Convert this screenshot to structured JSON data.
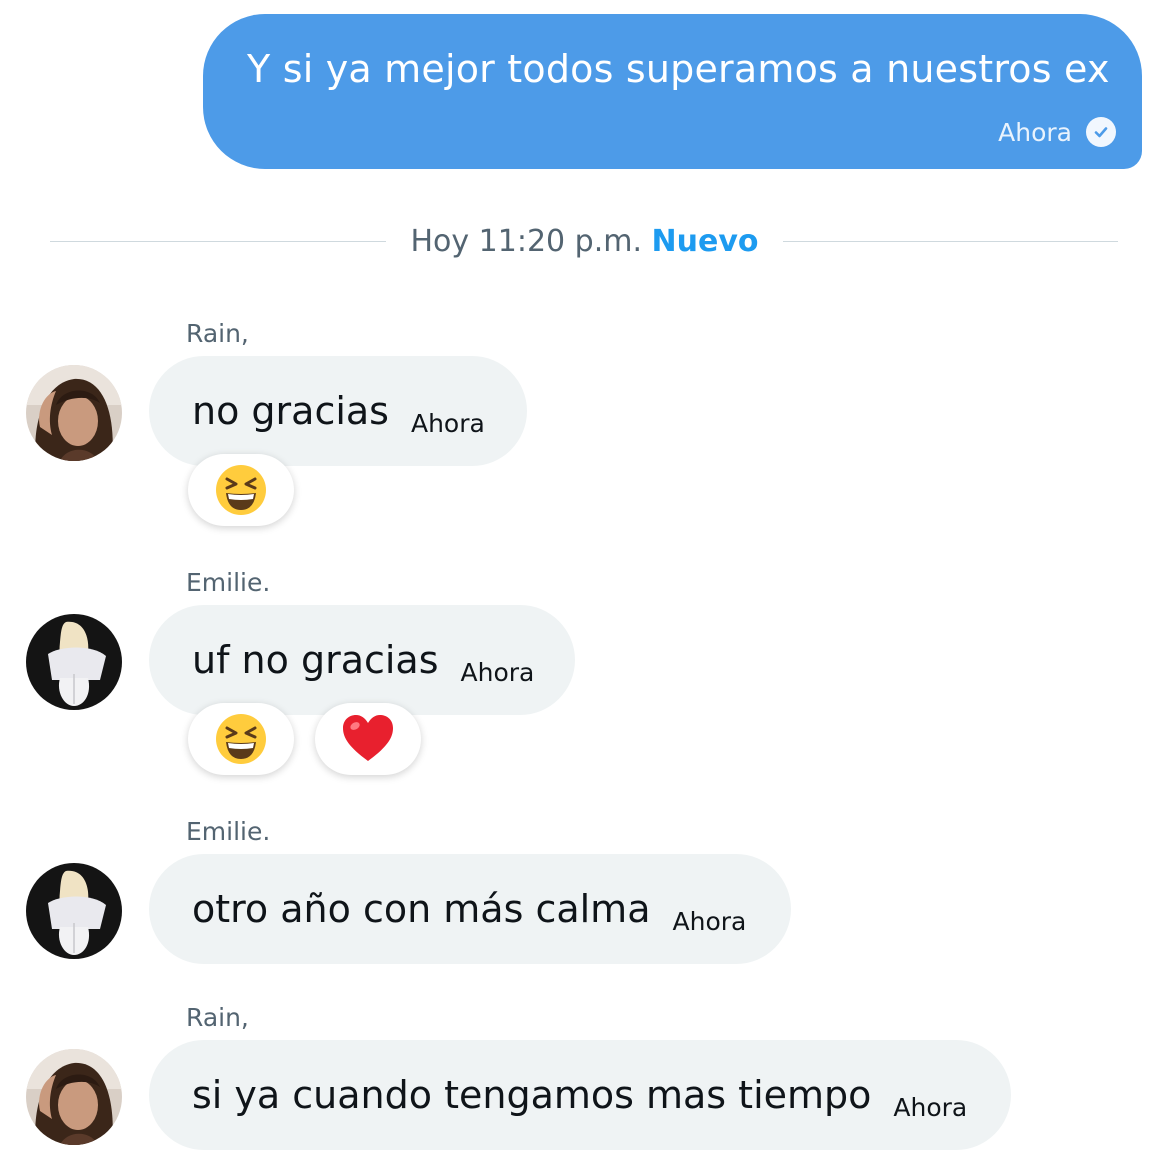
{
  "outgoing": {
    "text": "Y si ya mejor todos superamos a nuestros ex",
    "time": "Ahora",
    "status_icon": "check-circle-icon",
    "bubble_color": "#4d9be8"
  },
  "divider": {
    "label": "Hoy 11:20 p.m.",
    "new_label": "Nuevo",
    "new_color": "#1d9bf0"
  },
  "messages": [
    {
      "sender": "Rain,",
      "avatar_icon": "avatar-rain",
      "text": "no gracias",
      "time": "Ahora",
      "reactions": [
        "grinning-squinting-face-emoji"
      ]
    },
    {
      "sender": "Emilie.",
      "avatar_icon": "avatar-emilie",
      "text": "uf no gracias",
      "time": "Ahora",
      "reactions": [
        "grinning-squinting-face-emoji",
        "red-heart-emoji"
      ]
    },
    {
      "sender": "Emilie.",
      "avatar_icon": "avatar-emilie",
      "text": "otro año con más calma",
      "time": "Ahora",
      "reactions": []
    },
    {
      "sender": "Rain,",
      "avatar_icon": "avatar-rain",
      "text": "si ya cuando tengamos mas tiempo",
      "time": "Ahora",
      "reactions": []
    }
  ]
}
